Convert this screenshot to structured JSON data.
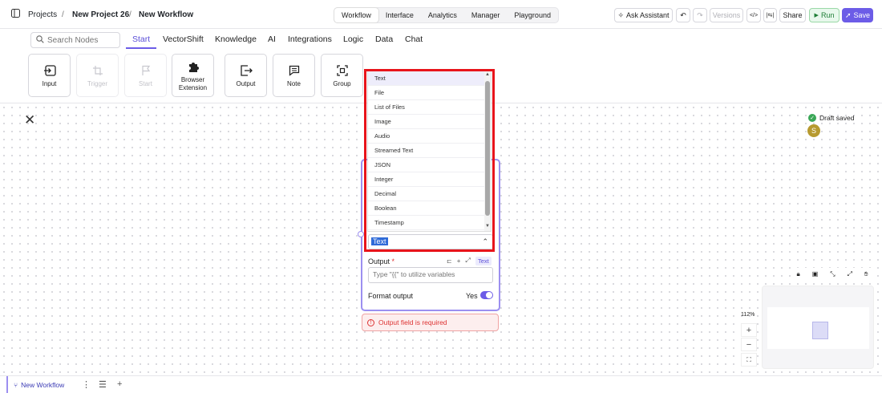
{
  "breadcrumb": {
    "projects": "Projects",
    "project": "New Project 26",
    "workflow": "New Workflow"
  },
  "topnav": [
    "Workflow",
    "Interface",
    "Analytics",
    "Manager",
    "Playground"
  ],
  "toolbar": {
    "ask_assistant": "Ask Assistant",
    "versions": "Versions",
    "share": "Share",
    "run": "Run",
    "save": "Save"
  },
  "search": {
    "placeholder": "Search Nodes"
  },
  "categories": [
    "Start",
    "VectorShift",
    "Knowledge",
    "AI",
    "Integrations",
    "Logic",
    "Data",
    "Chat"
  ],
  "tiles": {
    "input": "Input",
    "trigger": "Trigger",
    "start": "Start",
    "browser1": "Browser",
    "browser2": "Extension",
    "output": "Output",
    "note": "Note",
    "group": "Group"
  },
  "status": {
    "draft": "Draft saved",
    "avatar": "S"
  },
  "node": {
    "type_value": "Text",
    "output_label": "Output",
    "text_badge": "Text",
    "output_placeholder": "Type \"{{\" to utilize variables",
    "format_label": "Format output",
    "format_value": "Yes",
    "error": "Output field is required"
  },
  "dropdown": {
    "options": [
      "Text",
      "File",
      "List of Files",
      "Image",
      "Audio",
      "Streamed Text",
      "JSON",
      "Integer",
      "Decimal",
      "Boolean",
      "Timestamp"
    ]
  },
  "zoom": "112%",
  "bottombar": {
    "tab": "New Workflow"
  }
}
